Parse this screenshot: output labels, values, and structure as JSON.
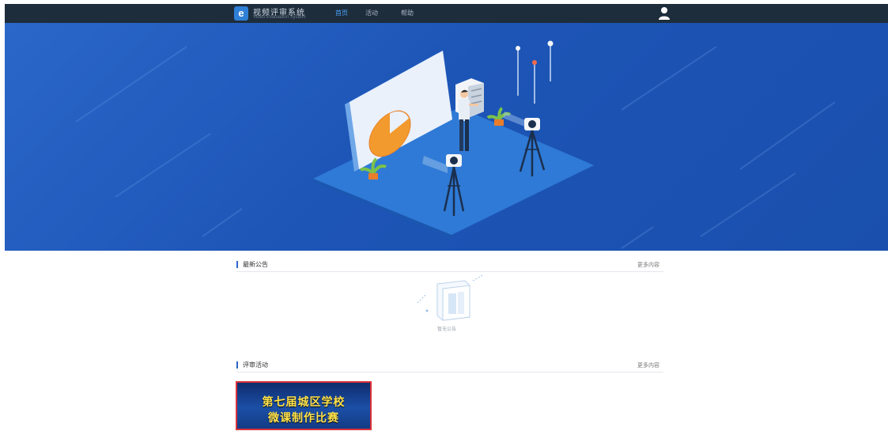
{
  "header": {
    "logo_letter": "e",
    "title": "视频评审系统",
    "subtitle": "Video Evaluation System",
    "nav": [
      {
        "label": "首页",
        "active": true
      },
      {
        "label": "活动",
        "active": false
      },
      {
        "label": "帮助",
        "active": false
      }
    ],
    "user_icon": "user-icon"
  },
  "notice": {
    "title": "最新公告",
    "more": "更多内容",
    "empty_text": "暂无公告"
  },
  "activities": {
    "title": "评审活动",
    "more": "更多内容",
    "card": {
      "line1": "第七届城区学校",
      "line2": "微课制作比赛"
    }
  },
  "colors": {
    "topbar": "#1e2d3b",
    "hero": "#1f58b9",
    "accent": "#2a67c8",
    "card_border": "#d9323a",
    "card_text": "#ffe24a"
  }
}
